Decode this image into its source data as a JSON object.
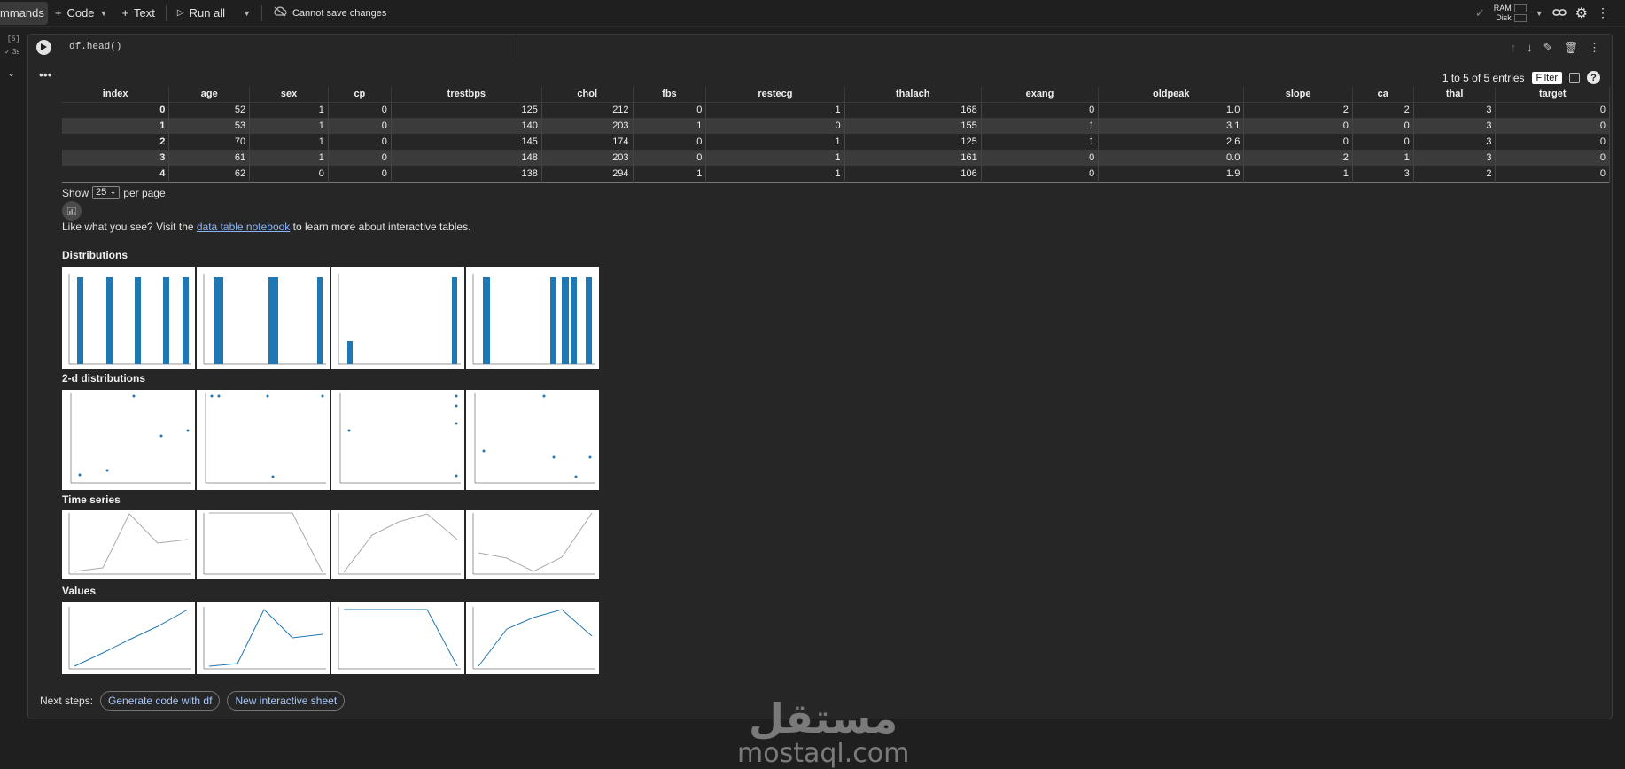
{
  "toolbar": {
    "commands": "mmands",
    "code": "Code",
    "text": "Text",
    "run_all": "Run all",
    "cannot_save": "Cannot save changes",
    "ram": "RAM",
    "disk": "Disk"
  },
  "cell": {
    "exec_count": "[5]",
    "duration": "3s",
    "code": "df.head()"
  },
  "table": {
    "info": "1 to 5 of 5 entries",
    "filter": "Filter",
    "columns": [
      "index",
      "age",
      "sex",
      "cp",
      "trestbps",
      "chol",
      "fbs",
      "restecg",
      "thalach",
      "exang",
      "oldpeak",
      "slope",
      "ca",
      "thal",
      "target"
    ],
    "rows": [
      [
        "0",
        "52",
        "1",
        "0",
        "125",
        "212",
        "0",
        "1",
        "168",
        "0",
        "1.0",
        "2",
        "2",
        "3",
        "0"
      ],
      [
        "1",
        "53",
        "1",
        "0",
        "140",
        "203",
        "1",
        "0",
        "155",
        "1",
        "3.1",
        "0",
        "0",
        "3",
        "0"
      ],
      [
        "2",
        "70",
        "1",
        "0",
        "145",
        "174",
        "0",
        "1",
        "125",
        "1",
        "2.6",
        "0",
        "0",
        "3",
        "0"
      ],
      [
        "3",
        "61",
        "1",
        "0",
        "148",
        "203",
        "0",
        "1",
        "161",
        "0",
        "0.0",
        "2",
        "1",
        "3",
        "0"
      ],
      [
        "4",
        "62",
        "0",
        "0",
        "138",
        "294",
        "1",
        "1",
        "106",
        "0",
        "1.9",
        "1",
        "3",
        "2",
        "0"
      ]
    ],
    "show_label": "Show",
    "per_page_value": "25",
    "per_page_label": "per page"
  },
  "promo": {
    "before": "Like what you see? Visit the ",
    "link": "data table notebook",
    "after": " to learn more about interactive tables."
  },
  "sections": {
    "distributions": "Distributions",
    "distributions_2d": "2-d distributions",
    "time_series": "Time series",
    "values": "Values"
  },
  "next_steps": {
    "label": "Next steps:",
    "gen_code": "Generate code with df",
    "sheet": "New interactive sheet"
  },
  "watermark": {
    "arabic": "مستقل",
    "latin": "mostaql.com"
  },
  "colors": {
    "accent": "#1f77b4",
    "link": "#8ab4f8",
    "background": "#1f1f1f"
  }
}
